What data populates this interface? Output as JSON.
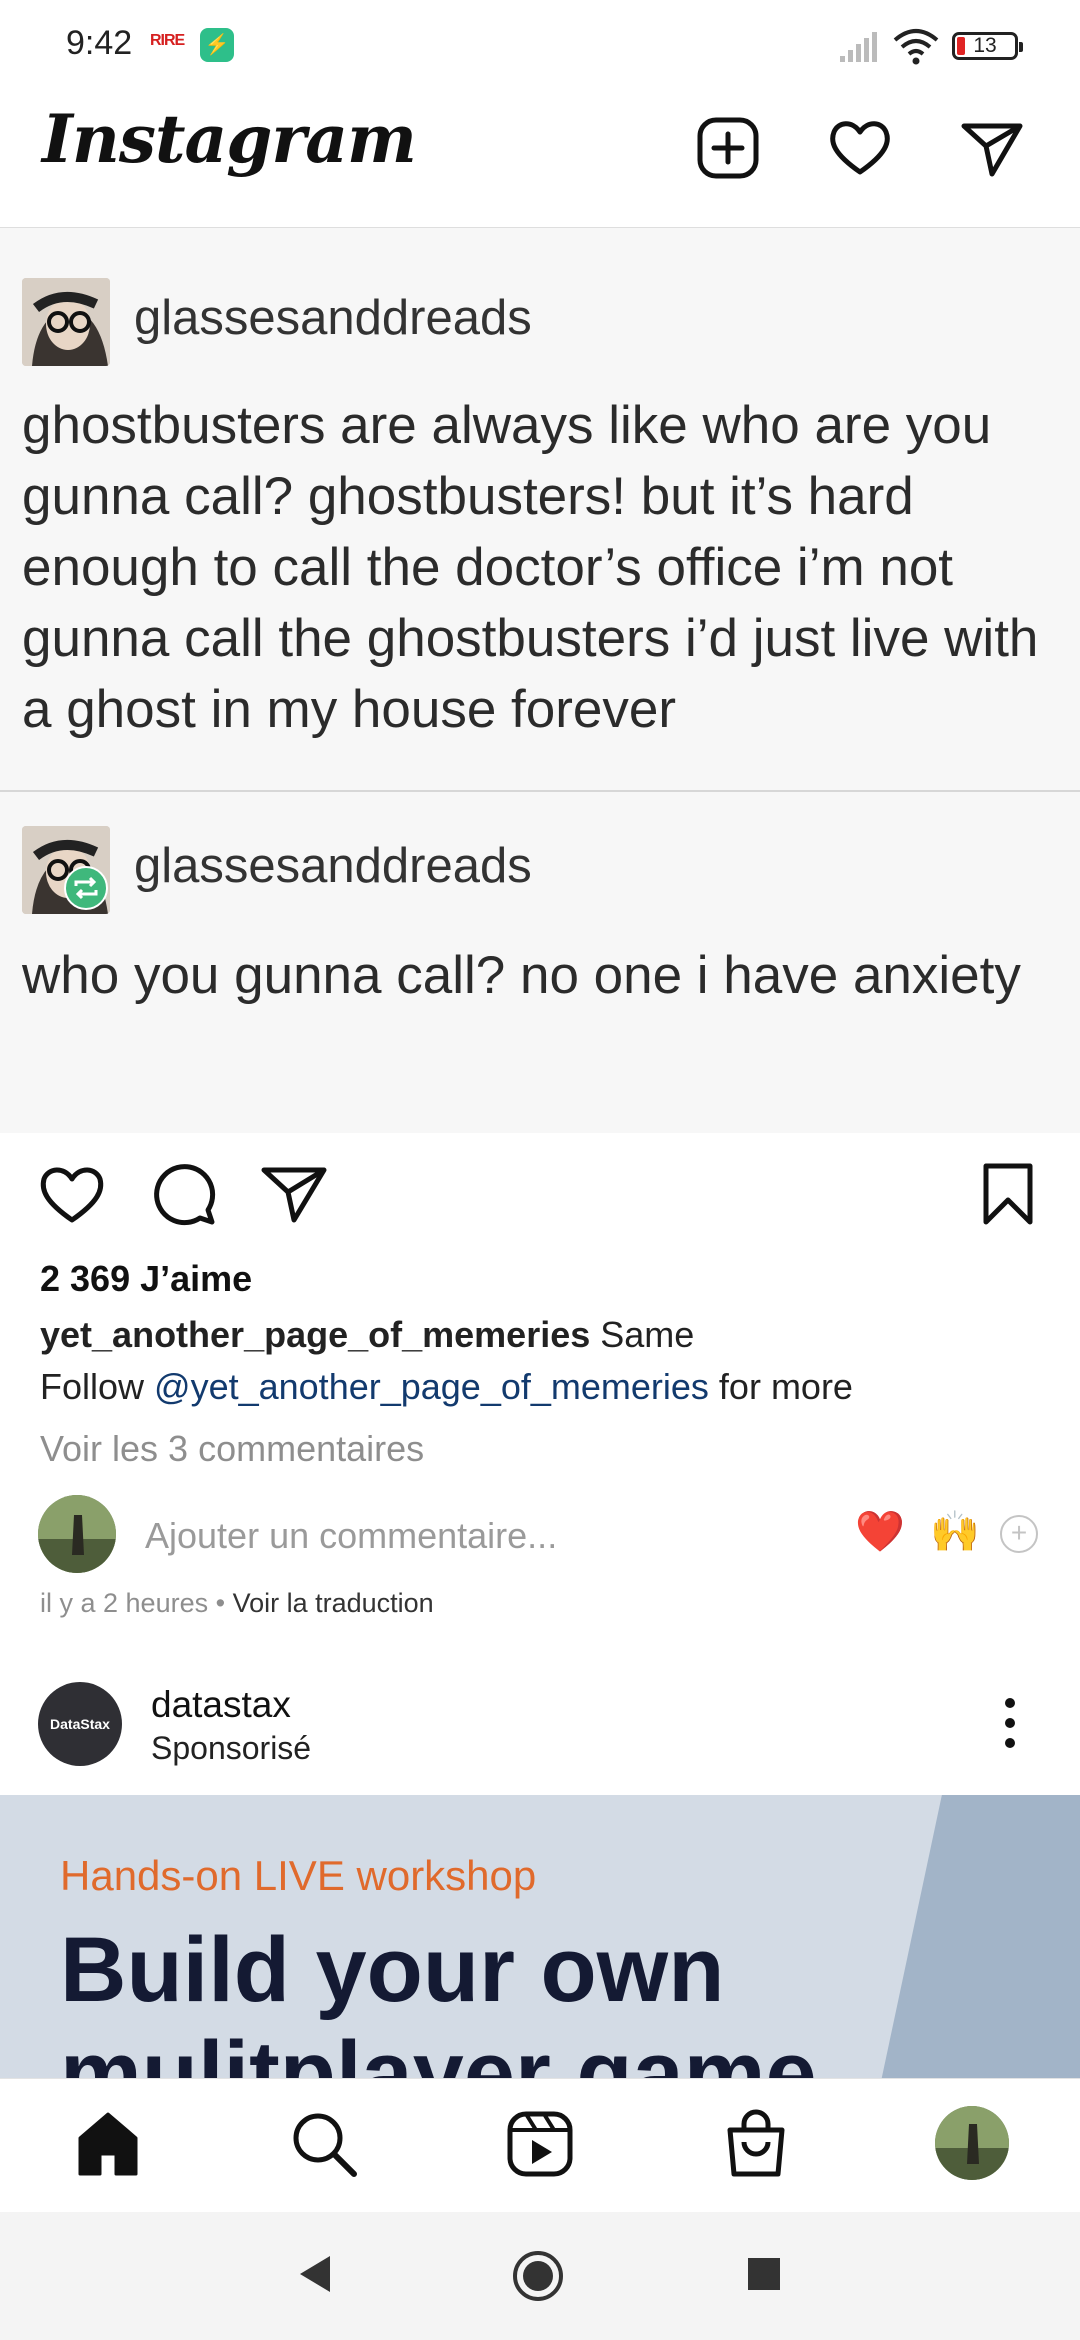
{
  "status_bar": {
    "time": "9:42",
    "badge_red": "RIRE",
    "battery": "13",
    "icons": [
      "signal-icon",
      "wifi-icon",
      "battery-icon"
    ]
  },
  "header": {
    "logo": "Instagram",
    "icons": [
      "new-post-icon",
      "heart-icon",
      "direct-message-icon"
    ]
  },
  "post": {
    "image": {
      "first_user": "glassesanddreads",
      "first_text": "ghostbusters are always like who are you gunna call? ghostbusters! but it’s hard enough to call the doctor’s office i’m not gunna call the ghostbusters i’d just live with a ghost in my house forever",
      "second_user": "glassesanddreads",
      "second_text": "who you gunna call? no one i have anxiety"
    },
    "likes": "2 369 J’aime",
    "caption_user": "yet_another_page_of_memeries",
    "caption_text": " Same",
    "caption_line2_prefix": "Follow ",
    "caption_mention": "@yet_another_page_of_memeries",
    "caption_line2_suffix": " for more",
    "view_comments": "Voir les 3 commentaires",
    "comment_placeholder": "Ajouter un commentaire...",
    "quick_emojis": [
      "❤️",
      "🙌"
    ],
    "time_ago": "il y a 2 heures",
    "separator": " • ",
    "translation": "Voir la traduction"
  },
  "sponsored": {
    "avatar_label": "DataStax",
    "user": "datastax",
    "label": "Sponsorisé",
    "kicker": "Hands-on LIVE workshop",
    "headline": "Build your own mulitplayer game"
  },
  "bottom_nav": {
    "items": [
      "home-icon",
      "search-icon",
      "reels-icon",
      "shop-icon",
      "profile-avatar"
    ]
  },
  "colors": {
    "mention": "#123a6e",
    "muted": "#8e8e8e",
    "ad_orange": "#e06a2c",
    "ad_navy": "#141a33"
  }
}
